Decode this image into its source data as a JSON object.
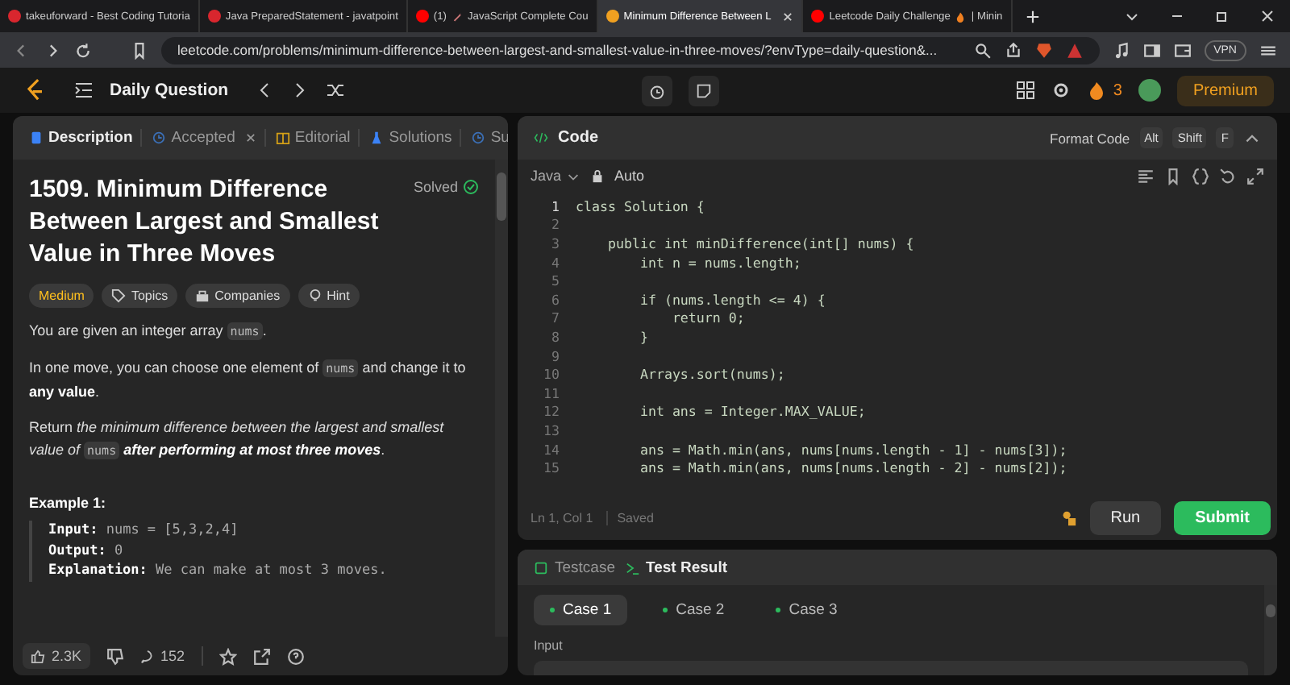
{
  "browser": {
    "tabs": [
      {
        "title": "takeuforward - Best Coding Tutoria",
        "kind": "tuf",
        "selected": false
      },
      {
        "title": "Java PreparedStatement - javatpoint",
        "kind": "jtp",
        "selected": false
      },
      {
        "badge": "(1)",
        "title": "JavaScript Complete Cou",
        "kind": "video",
        "emoji": true,
        "selected": false
      },
      {
        "title": "Minimum Difference Between L",
        "kind": "code",
        "selected": true
      },
      {
        "title": "Leetcode Daily Challenge",
        "suffix": "| Minin",
        "kind": "video",
        "emoji": true,
        "selected": false
      }
    ],
    "url": "leetcode.com/problems/minimum-difference-between-largest-and-smallest-value-in-three-moves/?envType=daily-question&...",
    "vpn": "VPN"
  },
  "nav": {
    "title": "Daily Question",
    "streak": "3",
    "premium": "Premium"
  },
  "left": {
    "tabs": [
      {
        "label": "Description",
        "kind": "doc",
        "selected": true
      },
      {
        "label": "Accepted",
        "kind": "clock",
        "closable": true,
        "selected": false
      },
      {
        "label": "Editorial",
        "kind": "book",
        "selected": false
      },
      {
        "label": "Solutions",
        "kind": "flask",
        "selected": false
      },
      {
        "label": "Su",
        "kind": "clock",
        "selected": false
      }
    ],
    "title": "1509. Minimum Difference Between Largest and Smallest Value in Three Moves",
    "status": "Solved",
    "tags": [
      {
        "label": "Medium",
        "kind": "difficulty"
      },
      {
        "label": "Topics",
        "kind": "topics"
      },
      {
        "label": "Companies",
        "kind": "companies"
      },
      {
        "label": "Hint",
        "kind": "hint"
      }
    ],
    "paragraphs": [
      [
        {
          "t": "You are given an integer array ",
          "kind": "plain"
        },
        {
          "t": "nums",
          "kind": "code"
        },
        {
          "t": ".",
          "kind": "plain"
        }
      ],
      [
        {
          "t": "In one move, you can choose one element of ",
          "kind": "plain"
        },
        {
          "t": "nums",
          "kind": "code"
        },
        {
          "t": " and change it to ",
          "kind": "plain"
        },
        {
          "t": "any value",
          "kind": "bold"
        },
        {
          "t": ".",
          "kind": "plain"
        }
      ],
      [
        {
          "t": "Return ",
          "kind": "plain"
        },
        {
          "t": "the minimum difference between the largest and smallest value of ",
          "kind": "italic"
        },
        {
          "t": "nums",
          "kind": "code"
        },
        {
          "t": " after performing at most three moves",
          "kind": "bolditalic"
        },
        {
          "t": ".",
          "kind": "plain"
        }
      ]
    ],
    "example_title": "Example 1:",
    "example": [
      {
        "k": "Input:",
        "v": "nums = [5,3,2,4]"
      },
      {
        "k": "Output:",
        "v": "0"
      },
      {
        "k": "Explanation:",
        "v": "We can make at most 3 moves."
      }
    ],
    "likes": "2.3K",
    "comments": "152"
  },
  "code": {
    "title": "Code",
    "format": "Format Code",
    "keys": [
      "Alt",
      "Shift",
      "F"
    ],
    "language": "Java",
    "mode": "Auto",
    "lines": [
      {
        "n": "1",
        "t": "class Solution {",
        "active": true
      },
      {
        "n": "2",
        "active": false
      },
      {
        "n": "3",
        "t": "    public int minDifference(int[] nums) {",
        "active": false
      },
      {
        "n": "4",
        "t": "        int n = nums.length;",
        "active": false
      },
      {
        "n": "5",
        "active": false
      },
      {
        "n": "6",
        "t": "        if (nums.length <= 4) {",
        "active": false
      },
      {
        "n": "7",
        "t": "            return 0;",
        "active": false
      },
      {
        "n": "8",
        "t": "        }",
        "active": false
      },
      {
        "n": "9",
        "active": false
      },
      {
        "n": "10",
        "t": "        Arrays.sort(nums);",
        "active": false
      },
      {
        "n": "11",
        "active": false
      },
      {
        "n": "12",
        "t": "        int ans = Integer.MAX_VALUE;",
        "active": false
      },
      {
        "n": "13",
        "active": false
      },
      {
        "n": "14",
        "t": "        ans = Math.min(ans, nums[nums.length - 1] - nums[3]);",
        "active": false
      },
      {
        "n": "15",
        "t": "        ans = Math.min(ans, nums[nums.length - 2] - nums[2]);",
        "active": false
      }
    ],
    "position": "Ln 1, Col 1",
    "saved": "Saved",
    "run": "Run",
    "submit": "Submit"
  },
  "test": {
    "tabs": [
      {
        "label": "Testcase",
        "kind": "check",
        "selected": false
      },
      {
        "label": "Test Result",
        "kind": "terminal",
        "selected": true
      }
    ],
    "cases": [
      {
        "label": "Case 1",
        "selected": true
      },
      {
        "label": "Case 2",
        "selected": false
      },
      {
        "label": "Case 3",
        "selected": false
      }
    ],
    "input_label": "Input"
  }
}
